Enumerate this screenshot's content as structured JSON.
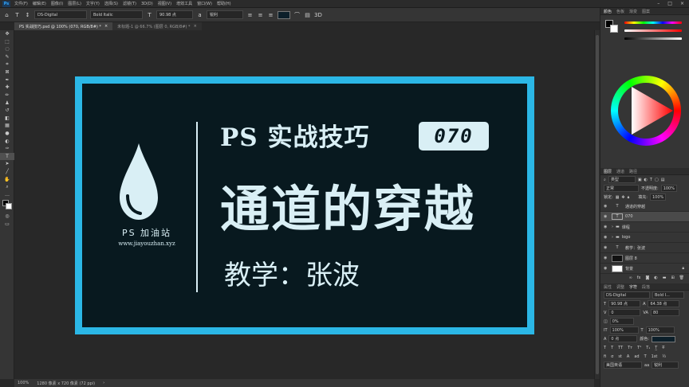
{
  "menubar": {
    "items": [
      "文件(F)",
      "编辑(E)",
      "图像(I)",
      "图层(L)",
      "文字(Y)",
      "选择(S)",
      "滤镜(T)",
      "3D(D)",
      "视图(V)",
      "增效工具",
      "窗口(W)",
      "帮助(H)"
    ]
  },
  "options": {
    "font_family": "DS-Digital",
    "font_style": "Bold Italic",
    "font_size": "90.98 点",
    "antialias": "锐利",
    "text_color": "#0c1f2a"
  },
  "tabs": [
    {
      "label": "PS 实战技巧.psd @ 100% (070, RGB/8#) *",
      "close": "×"
    },
    {
      "label": "未标题-1 @ 66.7% (图层 0, RGB/8#) *",
      "close": "×"
    }
  ],
  "document": {
    "title_line1": "PS 实战技巧",
    "number": "070",
    "title_line2": "通道的穿越",
    "teacher": "教学：张波",
    "logo_text": "PS 加油站",
    "logo_url": "www.jiayouzhan.xyz",
    "border_color": "#2bb7e6",
    "bg_color": "#08191f",
    "text_color": "#d9eff5"
  },
  "statusbar": {
    "zoom": "100%",
    "info": "1280 像素 x 720 像素 (72 ppi)"
  },
  "color_panel": {
    "tabs": [
      "颜色",
      "色板",
      "渐变",
      "图案"
    ]
  },
  "layers_panel": {
    "tabs": [
      "图层",
      "通道",
      "路径"
    ],
    "filter_label": "类型",
    "blend_mode": "正常",
    "opacity_label": "不透明度:",
    "opacity_value": "100%",
    "lock_label": "锁定:",
    "fill_label": "填充:",
    "fill_value": "100%",
    "layers": [
      {
        "name": "通道的穿越",
        "kind": "text",
        "selected": false
      },
      {
        "name": "070",
        "kind": "text",
        "selected": true
      },
      {
        "name": "课程",
        "kind": "folder",
        "selected": false
      },
      {
        "name": "logo",
        "kind": "folder",
        "selected": false
      },
      {
        "name": "教学：张波",
        "kind": "text",
        "selected": false
      },
      {
        "name": "图层 8",
        "kind": "pixel",
        "selected": false
      },
      {
        "name": "背景",
        "kind": "background",
        "selected": false
      }
    ]
  },
  "char_panel": {
    "tabs": [
      "属性",
      "调整",
      "字符",
      "段落"
    ],
    "font_family": "DS-Digital",
    "font_style": "Bold I...",
    "font_size": "90.98 点",
    "leading": "64.38 点",
    "kerning": "0",
    "tracking": "80",
    "scale_label": "0%",
    "vscale": "100%",
    "hscale": "100%",
    "baseline": "0 点",
    "color_label": "颜色:",
    "language": "美国英语",
    "antialias": "锐利"
  }
}
